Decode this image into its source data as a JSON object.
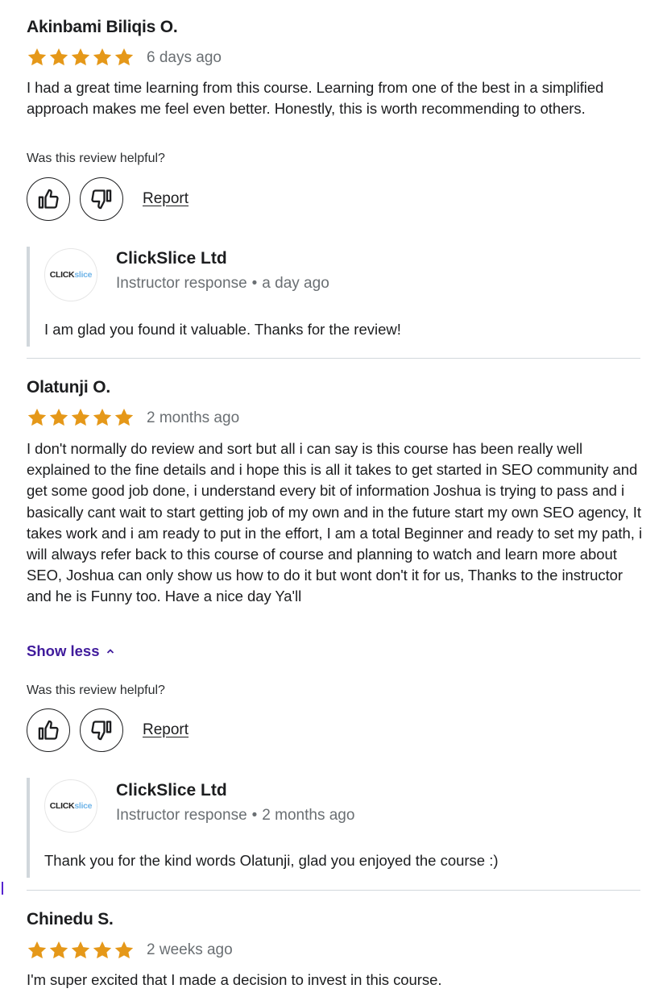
{
  "reviews": [
    {
      "name": "Akinbami Biliqis O.",
      "rating": 5,
      "date": "6 days ago",
      "text": "I had a great time learning from this course. Learning from one of the best in a simplified approach makes me feel even better. Honestly, this is worth recommending to others.",
      "helpful_label": "Was this review helpful?",
      "report_label": "Report",
      "response": {
        "name": "ClickSlice Ltd",
        "role": "Instructor response",
        "separator": "•",
        "date": "a day ago",
        "text": "I am glad you found it valuable. Thanks for the review!"
      }
    },
    {
      "name": "Olatunji O.",
      "rating": 5,
      "date": "2 months ago",
      "text": "I don't normally do review and sort but all i can say is this course has been really well explained to the fine details and i hope this is all it takes to get started in SEO community and get some good job done, i understand every bit of information Joshua is trying to pass and i basically cant wait to start getting job of my own and in the future start my own SEO agency, It takes work and i am ready to put in the effort, I am a total Beginner and ready to set my path, i will always refer back to this course of course and planning to watch and learn more about SEO, Joshua can only show us how to do it but wont don't it for us, Thanks to the instructor and he is Funny too. Have a nice day Ya'll",
      "show_less_label": "Show less",
      "helpful_label": "Was this review helpful?",
      "report_label": "Report",
      "response": {
        "name": "ClickSlice Ltd",
        "role": "Instructor response",
        "separator": "•",
        "date": "2 months ago",
        "text": "Thank you for the kind words Olatunji, glad you enjoyed the course :)"
      }
    },
    {
      "name": "Chinedu S.",
      "rating": 5,
      "date": "2 weeks ago",
      "text": "I'm super excited that I made a decision to invest in this course."
    }
  ],
  "logo": {
    "part1": "CLICK",
    "part2": "slice"
  },
  "icons": {
    "star": "star-icon",
    "thumbs_up": "thumbs-up-icon",
    "thumbs_down": "thumbs-down-icon",
    "chevron": "chevron-up-icon"
  },
  "colors": {
    "star": "#e59819",
    "link_purple": "#401b9c",
    "divider": "#d1d7dc"
  }
}
